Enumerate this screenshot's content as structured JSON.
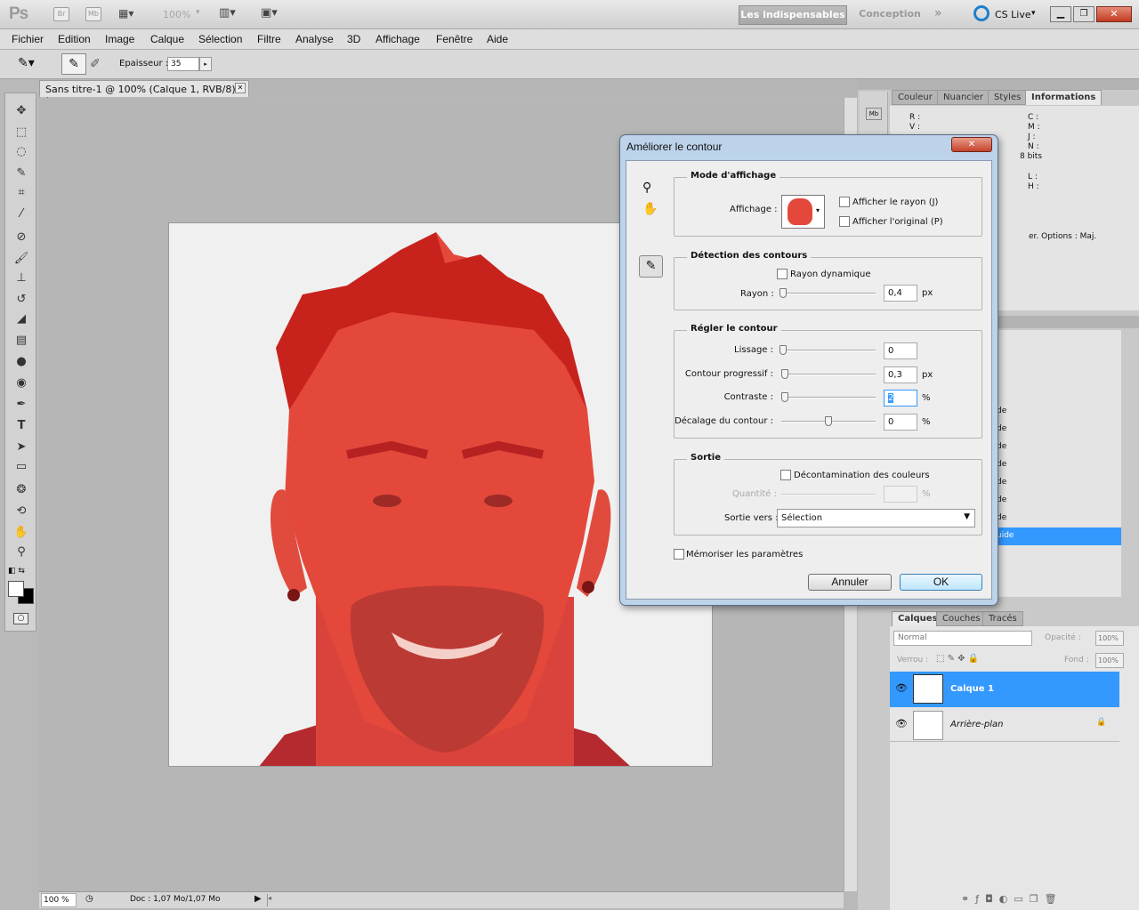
{
  "app": {
    "logo": "Ps",
    "bridge": "Br",
    "minibridge": "Mb",
    "zoom": "100%",
    "ws_active": "Les indispensables",
    "ws_other": "Conception",
    "cslive": "CS Live"
  },
  "menu": [
    "Fichier",
    "Edition",
    "Image",
    "Calque",
    "Sélection",
    "Filtre",
    "Analyse",
    "3D",
    "Affichage",
    "Fenêtre",
    "Aide"
  ],
  "options": {
    "epaisseur_label": "Epaisseur :",
    "epaisseur_value": "35"
  },
  "document": {
    "tab": "Sans titre-1 @ 100% (Calque 1, RVB/8) *",
    "zoom": "100 %",
    "doc_info": "Doc : 1,07 Mo/1,07 Mo"
  },
  "info_panel": {
    "tabs": [
      "Couleur",
      "Nuancier",
      "Styles",
      "Informations"
    ],
    "r": "R :",
    "v": "V :",
    "c": "C :",
    "m": "M :",
    "j": "J :",
    "n": "N :",
    "bits": "8 bits",
    "l": "L :",
    "h": "H :",
    "hint": "er. Options : Maj."
  },
  "history_items": [
    "de",
    "de",
    "de",
    "de",
    "de",
    "de",
    "de",
    "uide"
  ],
  "layers": {
    "tabs": [
      "Calques",
      "Couches",
      "Tracés"
    ],
    "blend": "Normal",
    "opacity_label": "Opacité :",
    "opacity": "100%",
    "lock_label": "Verrou :",
    "fill_label": "Fond :",
    "fill": "100%",
    "items": [
      {
        "name": "Calque 1",
        "selected": true
      },
      {
        "name": "Arrière-plan",
        "selected": false
      }
    ]
  },
  "dialog": {
    "title": "Améliorer le contour",
    "mode": {
      "title": "Mode d'affichage",
      "affichage_label": "Affichage :",
      "show_radius": "Afficher le rayon (J)",
      "show_original": "Afficher l'original (P)"
    },
    "detection": {
      "title": "Détection des contours",
      "smart_radius": "Rayon dynamique",
      "rayon_label": "Rayon :",
      "rayon_value": "0,4",
      "rayon_unit": "px"
    },
    "adjust": {
      "title": "Régler le contour",
      "rows": [
        {
          "label": "Lissage :",
          "value": "0",
          "unit": "",
          "pos": 0
        },
        {
          "label": "Contour progressif :",
          "value": "0,3",
          "unit": "px",
          "pos": 0.02
        },
        {
          "label": "Contraste :",
          "value": "2",
          "unit": "%",
          "pos": 0.02
        },
        {
          "label": "Décalage du contour :",
          "value": "0",
          "unit": "%",
          "pos": 0.5
        }
      ]
    },
    "output": {
      "title": "Sortie",
      "decontam": "Décontamination des couleurs",
      "quantite_label": "Quantité :",
      "quantite_unit": "%",
      "sortie_label": "Sortie vers :",
      "sortie_value": "Sélection"
    },
    "remember": "Mémoriser les paramètres",
    "cancel": "Annuler",
    "ok": "OK"
  }
}
